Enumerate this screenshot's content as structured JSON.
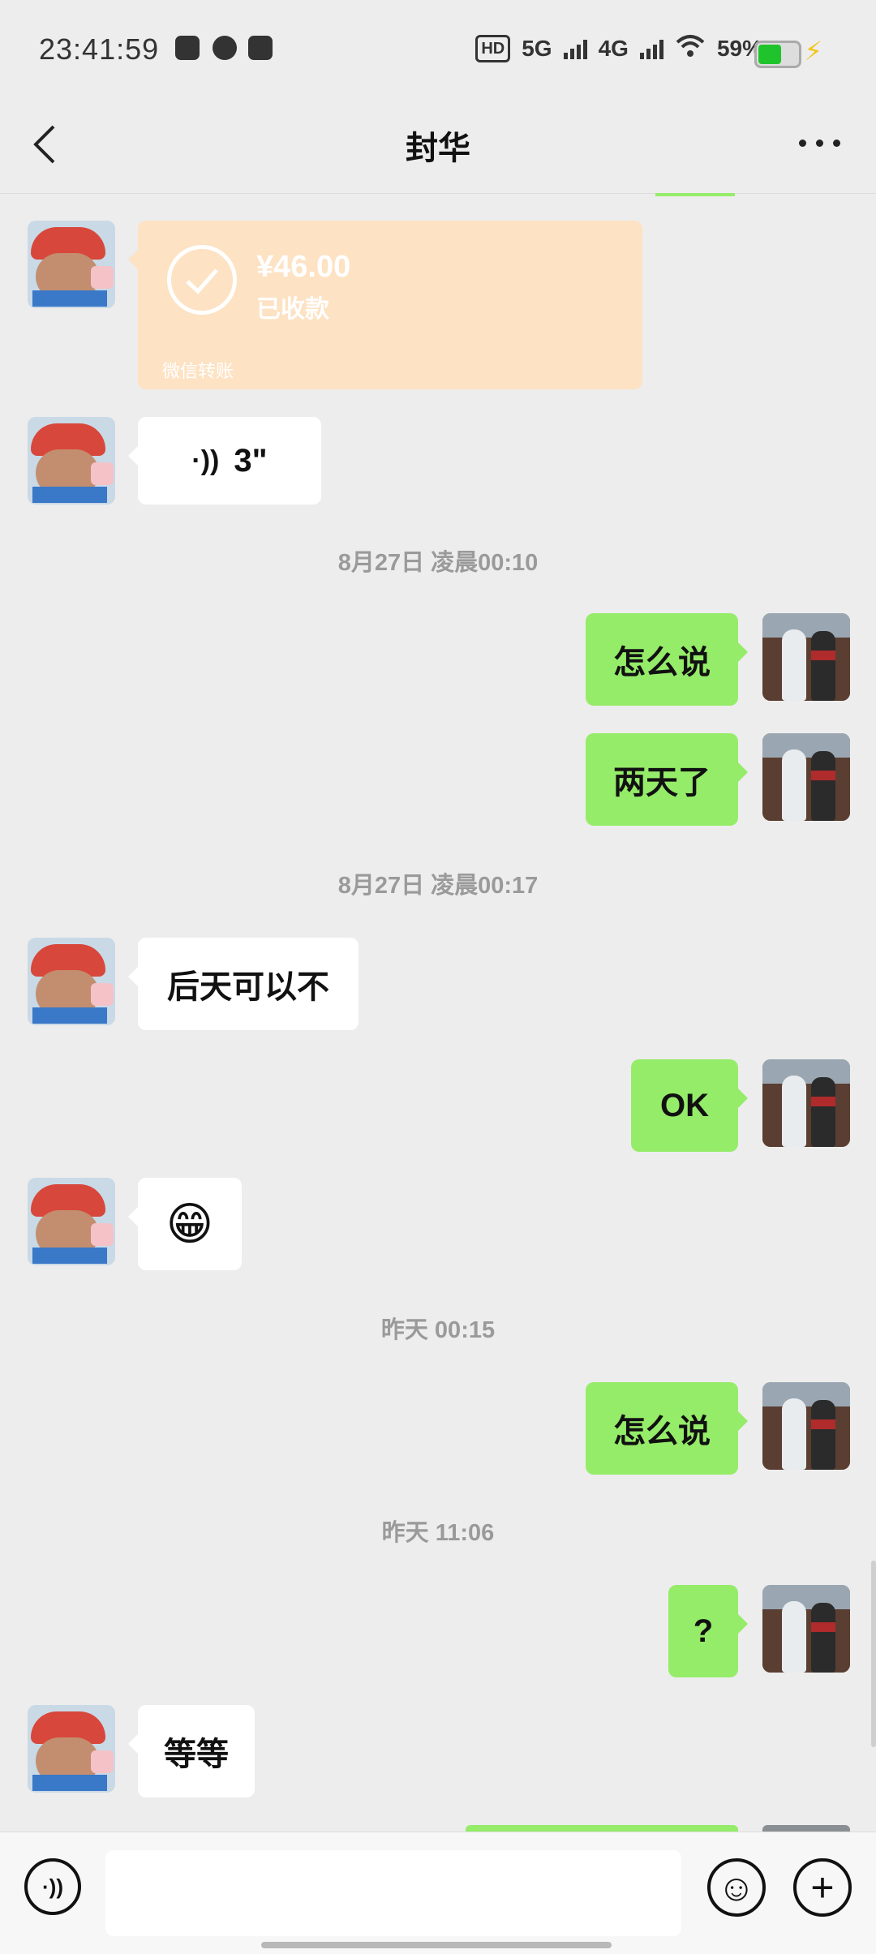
{
  "status_bar": {
    "time": "23:41:59",
    "hd": "HD",
    "net1": "5G",
    "net2": "4G",
    "battery": "59%",
    "battery_level": 0.59
  },
  "header": {
    "title": "封华"
  },
  "transfer": {
    "amount": "¥46.00",
    "status": "已收款",
    "footer": "微信转账"
  },
  "voice_message": {
    "icon": "·))",
    "duration": "3\""
  },
  "messages": {
    "t1": "8月27日 凌晨00:10",
    "m1": "怎么说",
    "m2": "两天了",
    "t2": "8月27日 凌晨00:17",
    "m3": "后天可以不",
    "m4": "OK",
    "m5": "😁",
    "t3": "昨天 00:15",
    "m6": "怎么说",
    "t4": "昨天 11:06",
    "m7": "?",
    "m8": "等等"
  },
  "input_bar": {
    "voice_glyph": "·))",
    "emoji_glyph": "☺",
    "plus_glyph": "+",
    "placeholder": ""
  },
  "colors": {
    "sent_bubble": "#95ec69",
    "received_bubble": "#ffffff",
    "transfer_card": "#fde2c3",
    "background": "#ededed"
  }
}
